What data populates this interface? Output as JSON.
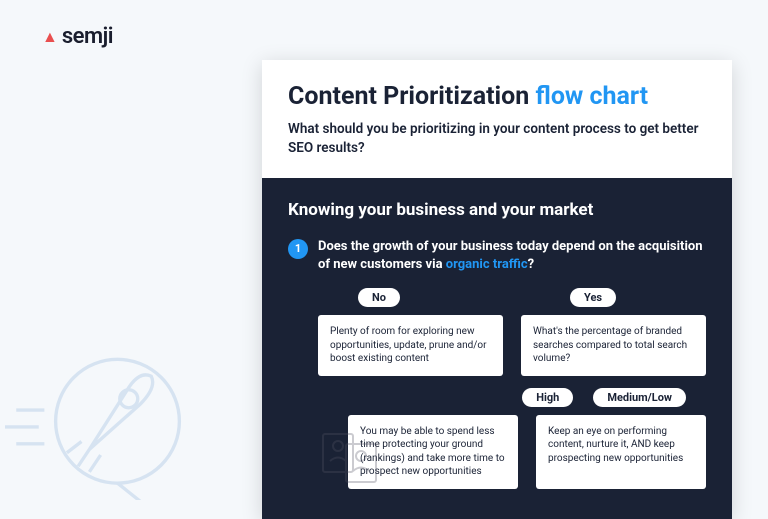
{
  "brand": {
    "mark": "▲",
    "name": "semji"
  },
  "header": {
    "title_main": "Content Prioritization ",
    "title_accent": "flow chart",
    "subtitle": "What should you be prioritizing in your content process to get better SEO results?"
  },
  "section": {
    "title": "Knowing your business and your market",
    "badge": "1",
    "question_pre": "Does the growth of your business today depend on the acquisition of new customers via ",
    "question_highlight": "organic traffic",
    "question_post": "?"
  },
  "flow": {
    "branch_no": "No",
    "branch_yes": "Yes",
    "box_no": "Plenty of room for exploring new opportunities, update, prune and/or boost existing content",
    "box_yes": "What's the percentage of branded searches compared to total search volume?",
    "branch_high": "High",
    "branch_medlow": "Medium/Low",
    "box_high": "You may be able to spend less time protecting your ground (rankings) and take more time to prospect new opportunities",
    "box_medlow": "Keep an eye on performing content, nurture it, AND keep prospecting new opportunities"
  }
}
